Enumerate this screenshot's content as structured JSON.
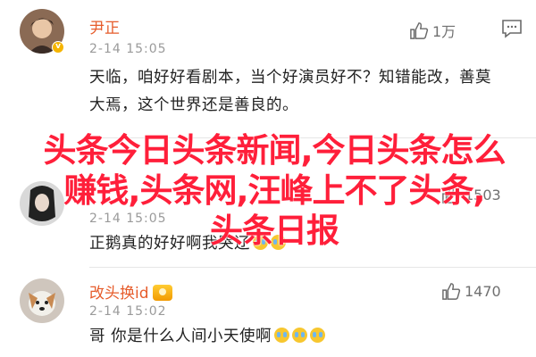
{
  "comments": [
    {
      "username": "尹正",
      "time": "2-14 15:05",
      "text": "天临，咱好好看剧本，当个好演员好不？知错能改，善莫大焉，这个世界还是善良的。",
      "likes": "1万",
      "avatar": "photo"
    },
    {
      "username": "",
      "time": "2-14 15:05",
      "text": "正鹅真的好好啊我哭辽",
      "likes": "1503",
      "avatar": "photo"
    },
    {
      "username": "改头换id",
      "time": "2-14 15:02",
      "text": "哥 你是什么人间小天使啊",
      "likes": "1470",
      "avatar": "dog"
    }
  ],
  "overlay": {
    "line1": "头条今日头条新闻,今日头条怎么",
    "line2": "赚钱,头条网,汪峰上不了头条,",
    "line3": "头条日报"
  },
  "icons": {
    "like": "thumbs-up-icon",
    "comment": "comment-icon",
    "verified": "verified-badge-icon",
    "emoji": "crying-emoji-icon"
  },
  "colors": {
    "username": "#e65c2b",
    "overlay": "#ff1f3a",
    "time": "#9a9a9a"
  }
}
